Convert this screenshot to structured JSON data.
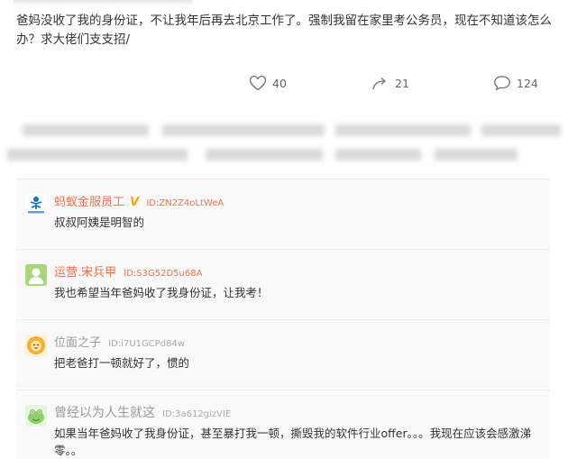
{
  "post": {
    "text": "爸妈没收了我的身份证，不让我年后再去北京工作了。强制我留在家里考公务员，现在不知道该怎么办？求大佬们支支招/"
  },
  "actions": {
    "like_count": "40",
    "repost_count": "21",
    "comment_count": "124",
    "like_icon": "heart-icon",
    "repost_icon": "repost-arrow-icon",
    "comment_icon": "speech-bubble-icon"
  },
  "comments": [
    {
      "name": "蚂蚁金服员工",
      "badge": "V",
      "id_text": "ID:ZN2Z4oLtWeA",
      "text": "叔叔阿姨是明智的",
      "avatar_icon": "ant-logo-icon",
      "avatar_caption": "蚂蚁金服"
    },
    {
      "name": "运营.宋兵甲",
      "id_text": "ID:S3G52D5u68A",
      "text": "我也希望当年爸妈收了我身份证，让我考！",
      "avatar_icon": "person-avatar-icon"
    },
    {
      "name": "位面之子",
      "id_text": "ID:i7U1GCPd84w",
      "text": "把老爸打一顿就好了，惯的",
      "avatar_icon": "lion-avatar-icon"
    },
    {
      "name": "曾经以为人生就这",
      "id_text": "ID:3a612gizVIE",
      "text": "如果当年爸妈收了我身份证，甚至暴打我一顿，撕毁我的软件行业offer。。。我现在应该会感激涕零。。",
      "avatar_icon": "frog-avatar-icon"
    }
  ],
  "colors": {
    "username_accent": "#eb7350",
    "verified_badge": "#f7a600",
    "muted_username": "#9a9a9a",
    "comment_bg": "#f9f9f9"
  }
}
